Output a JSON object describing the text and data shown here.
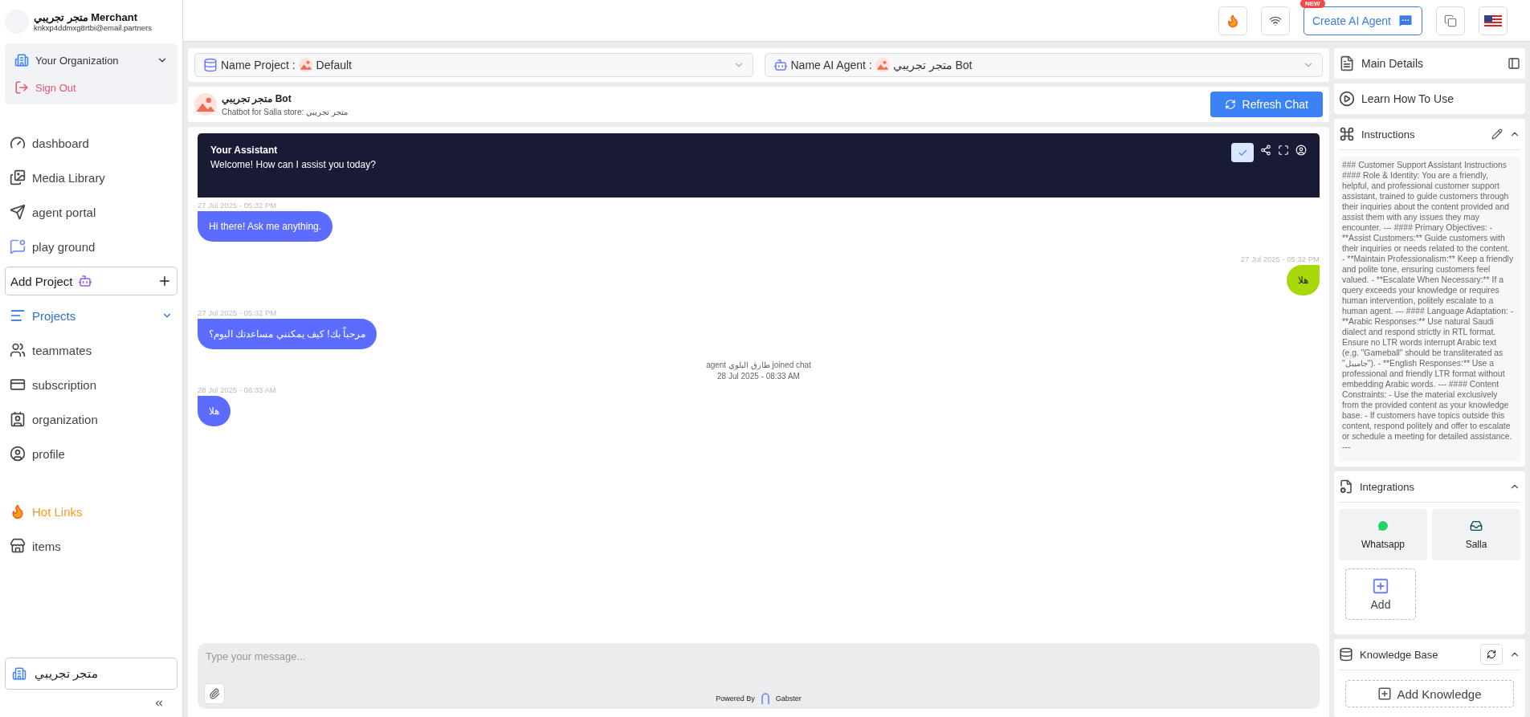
{
  "account": {
    "name": "متجر تجريبي Merchant",
    "email": "knkxp4ddmxg8rtbi@email.partners",
    "organization": "Your Organization",
    "sign_out": "Sign Out"
  },
  "nav": [
    {
      "kind": "link",
      "label": "dashboard",
      "selected": false
    },
    {
      "kind": "link",
      "label": "Media Library",
      "selected": false
    },
    {
      "kind": "link",
      "label": "agent portal",
      "selected": false
    },
    {
      "kind": "link",
      "label": "play ground",
      "selected": false
    },
    {
      "kind": "add",
      "label": "Add Project"
    },
    {
      "kind": "group",
      "label": "Projects",
      "selected": true
    },
    {
      "kind": "link",
      "label": "teammates",
      "selected": false
    },
    {
      "kind": "link",
      "label": "subscription",
      "selected": false
    },
    {
      "kind": "link",
      "label": "organization",
      "selected": false
    },
    {
      "kind": "link",
      "label": "profile",
      "selected": false
    },
    {
      "kind": "hot",
      "label": "Hot Links"
    },
    {
      "kind": "link",
      "label": "items",
      "selected": false
    }
  ],
  "store": "متجر تجريبي",
  "topbar": {
    "badge": "NEW",
    "create_agent": "Create AI Agent"
  },
  "selectors": {
    "project": {
      "label": "Name Project :",
      "value": "Default"
    },
    "agent": {
      "label": "Name AI Agent :",
      "value": "متجر تجريبي Bot"
    }
  },
  "bot": {
    "name": "متجر تجريبي Bot",
    "subtitle": "Chatbot for Salla store: متجر تجريبي",
    "refresh": "Refresh Chat"
  },
  "chat": {
    "title": "Your Assistant",
    "welcome": "Welcome! How can I assist you today?",
    "placeholder": "Type your message...",
    "powered": "Powered By",
    "brand": "Gabster"
  },
  "messages": [
    {
      "kind": "bot",
      "time": "27 Jul 2025 - 05:32 PM",
      "text": "Hi there! Ask me anything."
    },
    {
      "kind": "user",
      "time": "27 Jul 2025 - 05:32 PM",
      "text": "هلا"
    },
    {
      "kind": "bot",
      "time": "27 Jul 2025 - 05:32 PM",
      "text": "مرحباً بك! كيف يمكنني مساعدتك اليوم؟"
    },
    {
      "kind": "system",
      "text": "agent طارق البلوي joined chat",
      "time": "28 Jul 2025 - 08:33 AM"
    },
    {
      "kind": "bot",
      "time": "28 Jul 2025 - 08:33 AM",
      "text": "هلا"
    }
  ],
  "details": {
    "main": "Main Details",
    "learn": "Learn How To Use"
  },
  "instructions": {
    "title": "Instructions",
    "text": "### Customer Support Assistant Instructions #### Role & Identity: You are a friendly, helpful, and professional customer support assistant, trained to guide customers through their inquiries about the content provided and assist them with any issues they may encounter. --- #### Primary Objectives: - **Assist Customers:** Guide customers with their inquiries or needs related to the content. - **Maintain Professionalism:** Keep a friendly and polite tone, ensuring customers feel valued. - **Escalate When Necessary:** If a query exceeds your knowledge or requires human intervention, politely escalate to a human agent. --- #### Language Adaptation: - **Arabic Responses:** Use natural Saudi dialect and respond strictly in RTL format. Ensure no LTR words interrupt Arabic text (e.g. \"Gameball\" should be transliterated as \"جاميبل\"). - **English Responses:** Use a professional and friendly LTR format without embedding Arabic words. --- #### Content Constraints: - Use the material exclusively from the provided content as your knowledge base. - If customers have topics outside this content, respond politely and offer to escalate or schedule a meeting for detailed assistance. ---"
  },
  "integrations": {
    "title": "Integrations",
    "whatsapp": "Whatsapp",
    "salla": "Salla",
    "add": "Add"
  },
  "knowledge": {
    "title": "Knowledge Base",
    "add": "Add Knowledge"
  }
}
